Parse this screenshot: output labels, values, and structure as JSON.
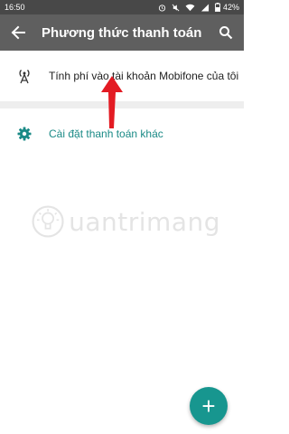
{
  "status_bar": {
    "time": "16:50",
    "battery": "42%",
    "icons": [
      "alarm-icon",
      "mute-icon",
      "wifi-icon",
      "signal-icon",
      "battery-icon"
    ]
  },
  "app_bar": {
    "title": "Phương thức thanh toán",
    "back_icon": "arrow-left-icon",
    "search_icon": "search-icon",
    "color": "#5f5f5f"
  },
  "payment_methods": [
    {
      "label": "Tính phí vào tài khoản Mobifone của tôi",
      "icon": "antenna-icon"
    }
  ],
  "other_settings": {
    "label": "Cài đặt thanh toán khác",
    "icon": "gear-icon",
    "color": "#1a8a86"
  },
  "watermark": {
    "text": "uantrimang",
    "icon": "lightbulb-logo"
  },
  "fab": {
    "symbol": "+",
    "color": "#17968f"
  }
}
